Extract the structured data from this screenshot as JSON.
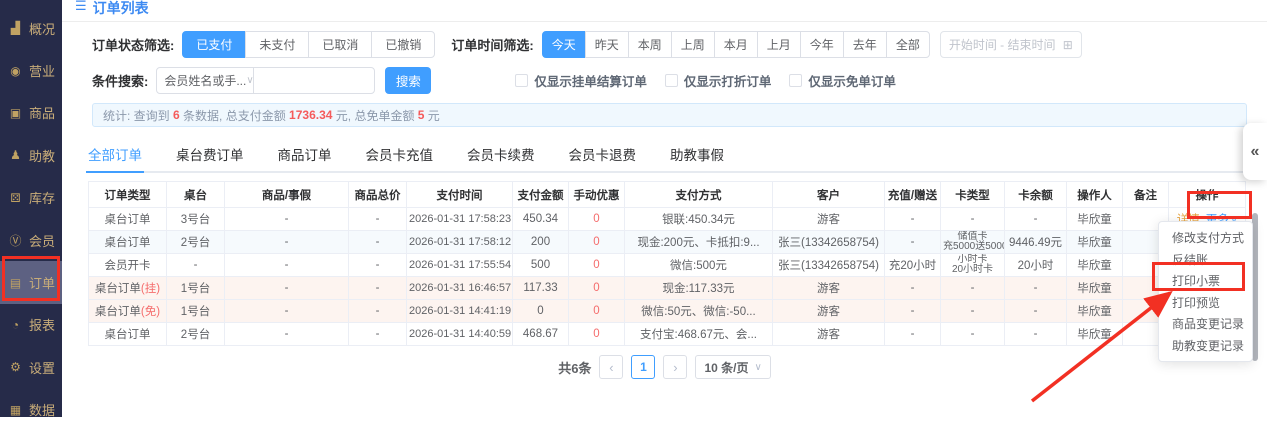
{
  "page": {
    "title_icon": "☰",
    "title": "订单列表"
  },
  "sidebar": {
    "items": [
      {
        "name": "overview",
        "icon": "▟",
        "label": "概况",
        "active": false
      },
      {
        "name": "business",
        "icon": "◉",
        "label": "营业",
        "active": false
      },
      {
        "name": "goods",
        "icon": "▣",
        "label": "商品",
        "active": false
      },
      {
        "name": "assistant",
        "icon": "♟",
        "label": "助教",
        "active": false
      },
      {
        "name": "inventory",
        "icon": "⚄",
        "label": "库存",
        "active": false
      },
      {
        "name": "member",
        "icon": "Ⓥ",
        "label": "会员",
        "active": false
      },
      {
        "name": "order",
        "icon": "▤",
        "label": "订单",
        "active": true
      },
      {
        "name": "report",
        "icon": "◔",
        "label": "报表",
        "active": false
      },
      {
        "name": "settings",
        "icon": "⚙",
        "label": "设置",
        "active": false
      },
      {
        "name": "data",
        "icon": "▦",
        "label": "数据",
        "active": false
      }
    ]
  },
  "filters": {
    "status_label": "订单状态筛选:",
    "status_options": [
      {
        "name": "paid",
        "label": "已支付",
        "active": true
      },
      {
        "name": "unpaid",
        "label": "未支付",
        "active": false
      },
      {
        "name": "cancelled",
        "label": "已取消",
        "active": false
      },
      {
        "name": "revoked",
        "label": "已撤销",
        "active": false
      }
    ],
    "time_label": "订单时间筛选:",
    "time_options": [
      {
        "name": "today",
        "label": "今天",
        "active": true
      },
      {
        "name": "yesterday",
        "label": "昨天",
        "active": false
      },
      {
        "name": "this-week",
        "label": "本周",
        "active": false
      },
      {
        "name": "last-week",
        "label": "上周",
        "active": false
      },
      {
        "name": "this-month",
        "label": "本月",
        "active": false
      },
      {
        "name": "last-month",
        "label": "上月",
        "active": false
      },
      {
        "name": "this-year",
        "label": "今年",
        "active": false
      },
      {
        "name": "last-year",
        "label": "去年",
        "active": false
      },
      {
        "name": "all",
        "label": "全部",
        "active": false
      }
    ],
    "date_range_placeholder": "开始时间 - 结束时间",
    "calendar_icon": "⊞",
    "search_label": "条件搜索:",
    "search_select_value": "会员姓名或手...",
    "select_caret": "∨",
    "search_input_value": "",
    "search_button": "搜索",
    "checkboxes": [
      {
        "name": "only-pending-settle",
        "label": "仅显示挂单结算订单",
        "checked": false
      },
      {
        "name": "only-discount",
        "label": "仅显示打折订单",
        "checked": false
      },
      {
        "name": "only-free",
        "label": "仅显示免单订单",
        "checked": false
      }
    ]
  },
  "stats": {
    "prefix": "统计: 查询到 ",
    "count": "6",
    "mid1": " 条数据, 总支付金额 ",
    "amount": "1736.34",
    "mid2": " 元, 总免单金额 ",
    "free": "5",
    "suffix": " 元"
  },
  "tabs": [
    {
      "name": "all-orders",
      "label": "全部订单",
      "active": true
    },
    {
      "name": "table-fee",
      "label": "桌台费订单",
      "active": false
    },
    {
      "name": "goods-orders",
      "label": "商品订单",
      "active": false
    },
    {
      "name": "card-recharge",
      "label": "会员卡充值",
      "active": false
    },
    {
      "name": "card-renew",
      "label": "会员卡续费",
      "active": false
    },
    {
      "name": "card-refund",
      "label": "会员卡退费",
      "active": false
    },
    {
      "name": "assistant-leave",
      "label": "助教事假",
      "active": false
    }
  ],
  "table": {
    "columns": [
      {
        "key": "type",
        "label": "订单类型"
      },
      {
        "key": "table_no",
        "label": "桌台"
      },
      {
        "key": "goods",
        "label": "商品/事假"
      },
      {
        "key": "goods_total",
        "label": "商品总价"
      },
      {
        "key": "pay_time",
        "label": "支付时间"
      },
      {
        "key": "pay_amount",
        "label": "支付金额"
      },
      {
        "key": "manual_discount",
        "label": "手动优惠"
      },
      {
        "key": "pay_method",
        "label": "支付方式"
      },
      {
        "key": "customer",
        "label": "客户"
      },
      {
        "key": "recharge",
        "label": "充值/赠送"
      },
      {
        "key": "card_type",
        "label": "卡类型"
      },
      {
        "key": "card_balance",
        "label": "卡余额"
      },
      {
        "key": "operator",
        "label": "操作人"
      },
      {
        "key": "remark",
        "label": "备注"
      },
      {
        "key": "actions",
        "label": "操作"
      }
    ],
    "actions": {
      "detail": "详情",
      "more": "更多",
      "more_caret": "∨"
    },
    "rows": [
      {
        "type": "桌台订单",
        "type_suffix": "",
        "table_no": "3号台",
        "goods": "-",
        "goods_total": "-",
        "pay_time": "2026-01-31 17:58:23",
        "pay_amount": "450.34",
        "manual_discount": "0",
        "pay_method": "银联:450.34元",
        "customer": "游客",
        "recharge": "-",
        "card_type": "-",
        "card_balance": "-",
        "operator": "毕欣童",
        "remark": "",
        "tint": ""
      },
      {
        "type": "桌台订单",
        "type_suffix": "",
        "table_no": "2号台",
        "goods": "-",
        "goods_total": "-",
        "pay_time": "2026-01-31 17:58:12",
        "pay_amount": "200",
        "manual_discount": "0",
        "pay_method": "现金:200元、卡抵扣:9...",
        "customer": "张三(13342658754)",
        "recharge": "-",
        "card_type": [
          "储值卡",
          "充5000送5000"
        ],
        "card_balance": "9446.49元",
        "operator": "毕欣童",
        "remark": "",
        "tint": "blue"
      },
      {
        "type": "会员开卡",
        "type_suffix": "",
        "table_no": "-",
        "goods": "-",
        "goods_total": "-",
        "pay_time": "2026-01-31 17:55:54",
        "pay_amount": "500",
        "manual_discount": "0",
        "pay_method": "微信:500元",
        "customer": "张三(13342658754)",
        "recharge": "充20小时",
        "card_type": [
          "小时卡",
          "20小时卡"
        ],
        "card_balance": "20小时",
        "operator": "毕欣童",
        "remark": "",
        "tint": ""
      },
      {
        "type": "桌台订单",
        "type_suffix": "(挂)",
        "table_no": "1号台",
        "goods": "-",
        "goods_total": "-",
        "pay_time": "2026-01-31 16:46:57",
        "pay_amount": "117.33",
        "manual_discount": "0",
        "pay_method": "现金:117.33元",
        "customer": "游客",
        "recharge": "-",
        "card_type": "-",
        "card_balance": "-",
        "operator": "毕欣童",
        "remark": "",
        "tint": "pink"
      },
      {
        "type": "桌台订单",
        "type_suffix": "(免)",
        "table_no": "1号台",
        "goods": "-",
        "goods_total": "-",
        "pay_time": "2026-01-31 14:41:19",
        "pay_amount": "0",
        "manual_discount": "0",
        "pay_method": "微信:50元、微信:-50...",
        "customer": "游客",
        "recharge": "-",
        "card_type": "-",
        "card_balance": "-",
        "operator": "毕欣童",
        "remark": "",
        "tint": "pink"
      },
      {
        "type": "桌台订单",
        "type_suffix": "",
        "table_no": "2号台",
        "goods": "-",
        "goods_total": "-",
        "pay_time": "2026-01-31 14:40:59",
        "pay_amount": "468.67",
        "manual_discount": "0",
        "pay_method": "支付宝:468.67元、会...",
        "customer": "游客",
        "recharge": "-",
        "card_type": "-",
        "card_balance": "-",
        "operator": "毕欣童",
        "remark": "",
        "tint": ""
      }
    ]
  },
  "dropdown": {
    "items": [
      {
        "name": "modify-payment",
        "label": "修改支付方式"
      },
      {
        "name": "reverse-settle",
        "label": "反结账"
      },
      {
        "name": "print-receipt",
        "label": "打印小票"
      },
      {
        "name": "print-preview",
        "label": "打印预览"
      },
      {
        "name": "goods-change-log",
        "label": "商品变更记录"
      },
      {
        "name": "assistant-change-log",
        "label": "助教变更记录"
      }
    ]
  },
  "pagination": {
    "total": "共6条",
    "prev_icon": "‹",
    "page": "1",
    "next_icon": "›",
    "page_size": "10 条/页",
    "size_caret": "∨"
  },
  "collapse_icon": "«",
  "colors": {
    "accent": "#409eff",
    "annotation": "#f23023",
    "sidebar_bg": "#262b49",
    "sidebar_gold": "#c9ad79",
    "danger": "#f56c6c",
    "detail_link": "#e6a23c"
  }
}
